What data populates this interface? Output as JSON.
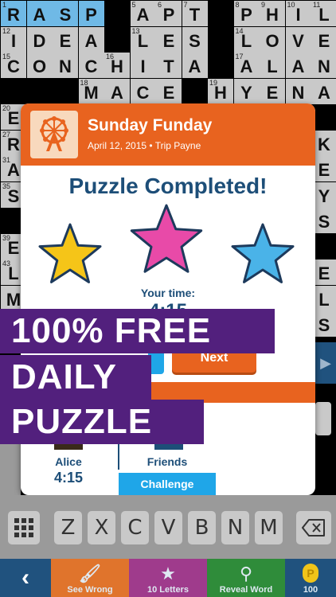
{
  "grid": {
    "cells": [
      {
        "r": 0,
        "c": 0,
        "n": "1",
        "ch": "R",
        "hl": true
      },
      {
        "r": 0,
        "c": 1,
        "ch": "A",
        "hl": true
      },
      {
        "r": 0,
        "c": 2,
        "ch": "S",
        "hl": true
      },
      {
        "r": 0,
        "c": 3,
        "ch": "P",
        "hl": true
      },
      {
        "r": 0,
        "c": 5,
        "n": "5",
        "ch": "A"
      },
      {
        "r": 0,
        "c": 6,
        "n": "6",
        "ch": "P"
      },
      {
        "r": 0,
        "c": 7,
        "n": "7",
        "ch": "T"
      },
      {
        "r": 0,
        "c": 9,
        "n": "8",
        "ch": "P"
      },
      {
        "r": 0,
        "c": 10,
        "n": "9",
        "ch": "H"
      },
      {
        "r": 0,
        "c": 11,
        "n": "10",
        "ch": "I"
      },
      {
        "r": 0,
        "c": 12,
        "n": "11",
        "ch": "L"
      },
      {
        "r": 1,
        "c": 0,
        "n": "12",
        "ch": "I"
      },
      {
        "r": 1,
        "c": 1,
        "ch": "D"
      },
      {
        "r": 1,
        "c": 2,
        "ch": "E"
      },
      {
        "r": 1,
        "c": 3,
        "ch": "A"
      },
      {
        "r": 1,
        "c": 5,
        "n": "13",
        "ch": "L"
      },
      {
        "r": 1,
        "c": 6,
        "ch": "E"
      },
      {
        "r": 1,
        "c": 7,
        "ch": "S"
      },
      {
        "r": 1,
        "c": 9,
        "n": "14",
        "ch": "L"
      },
      {
        "r": 1,
        "c": 10,
        "ch": "O"
      },
      {
        "r": 1,
        "c": 11,
        "ch": "V"
      },
      {
        "r": 1,
        "c": 12,
        "ch": "E"
      },
      {
        "r": 2,
        "c": 0,
        "n": "15",
        "ch": "C"
      },
      {
        "r": 2,
        "c": 1,
        "ch": "O"
      },
      {
        "r": 2,
        "c": 2,
        "ch": "N"
      },
      {
        "r": 2,
        "c": 3,
        "ch": "C"
      },
      {
        "r": 2,
        "c": 4,
        "n": "16",
        "ch": "H"
      },
      {
        "r": 2,
        "c": 5,
        "ch": "I"
      },
      {
        "r": 2,
        "c": 6,
        "ch": "T"
      },
      {
        "r": 2,
        "c": 7,
        "ch": "A"
      },
      {
        "r": 2,
        "c": 9,
        "n": "17",
        "ch": "A"
      },
      {
        "r": 2,
        "c": 10,
        "ch": "L"
      },
      {
        "r": 2,
        "c": 11,
        "ch": "A"
      },
      {
        "r": 2,
        "c": 12,
        "ch": "N"
      },
      {
        "r": 3,
        "c": 3,
        "n": "18",
        "ch": "M"
      },
      {
        "r": 3,
        "c": 4,
        "ch": "A"
      },
      {
        "r": 3,
        "c": 5,
        "ch": "C"
      },
      {
        "r": 3,
        "c": 6,
        "ch": "E"
      },
      {
        "r": 3,
        "c": 8,
        "n": "19",
        "ch": "H"
      },
      {
        "r": 3,
        "c": 9,
        "ch": "Y"
      },
      {
        "r": 3,
        "c": 10,
        "ch": "E"
      },
      {
        "r": 3,
        "c": 11,
        "ch": "N"
      },
      {
        "r": 3,
        "c": 12,
        "ch": "A"
      },
      {
        "r": 4,
        "c": 0,
        "n": "20",
        "ch": "E"
      },
      {
        "r": 5,
        "c": 0,
        "n": "27",
        "ch": "R"
      },
      {
        "r": 5,
        "c": 12,
        "ch": "K"
      },
      {
        "r": 6,
        "c": 0,
        "n": "31",
        "ch": "A"
      },
      {
        "r": 6,
        "c": 12,
        "ch": "E"
      },
      {
        "r": 7,
        "c": 0,
        "n": "35",
        "ch": "S"
      },
      {
        "r": 7,
        "c": 12,
        "ch": "Y"
      },
      {
        "r": 8,
        "c": 12,
        "ch": "S"
      },
      {
        "r": 9,
        "c": 0,
        "n": "39",
        "ch": "E"
      },
      {
        "r": 10,
        "c": 0,
        "n": "43",
        "ch": "L"
      },
      {
        "r": 10,
        "c": 12,
        "ch": "E"
      },
      {
        "r": 11,
        "c": 0,
        "n": "",
        "ch": "M"
      },
      {
        "r": 11,
        "c": 12,
        "ch": "L"
      },
      {
        "r": 12,
        "c": 12,
        "ch": "S"
      }
    ]
  },
  "modal": {
    "title": "Sunday Funday",
    "subtitle": "April 12, 2015 • Trip Payne",
    "completed": "Puzzle Completed!",
    "your_time_label": "Your time:",
    "your_time_value": "4:15",
    "next_label": "Next",
    "alice_name": "Alice",
    "alice_time": "4:15",
    "friends_label": "Friends",
    "challenge_label": "Challenge",
    "star_colors": [
      "#f5c518",
      "#e84aa8",
      "#4ab3e8"
    ]
  },
  "promo": {
    "line1": "100% FREE",
    "line2": "DAILY",
    "line3": "PUZZLE"
  },
  "keyboard": {
    "keys": [
      "Z",
      "X",
      "C",
      "V",
      "B",
      "N",
      "M"
    ],
    "grid_icon": "grid-icon",
    "backspace_icon": "backspace-icon"
  },
  "toolbar": {
    "back_icon": "chevron-left-icon",
    "see_wrong": "See Wrong",
    "ten_letters": "10 Letters",
    "reveal_word": "Reveal Word",
    "coins": "100"
  }
}
